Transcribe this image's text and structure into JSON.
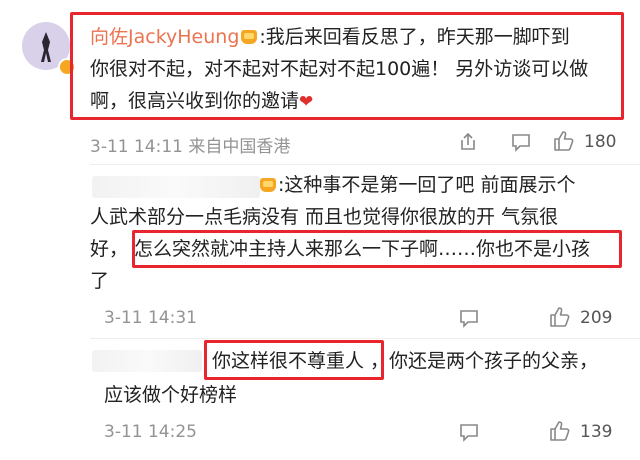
{
  "comment": {
    "author": "向佐JackyHeung",
    "line1": ":我后来回看反思了，昨天那一脚吓到",
    "line2": "你很对不起，对不起对不起对不起100遍！ 另外访谈可以做",
    "line3": "啊，很高兴收到你的邀请",
    "time": "3-11 14:11",
    "source": "来自中国香港",
    "likes": "180"
  },
  "replies": [
    {
      "line1": ":这种事不是第一回了吧 前面展示个",
      "line2": "人武术部分一点毛病没有 而且也觉得你很放的开 气氛很",
      "line3a": "好，",
      "line3b": "怎么突然就冲主持人来那么一下子啊……你也不是小孩",
      "line4": "了",
      "time": "3-11 14:31",
      "likes": "209"
    },
    {
      "line1a": "你这样很不尊重人",
      "line1b": "，你还是两个孩子的父亲，",
      "line2": "应该做个好榜样",
      "time": "3-11 14:25",
      "likes": "139"
    }
  ],
  "colors": {
    "accent": "#eb7350",
    "highlight_box": "#e8262f",
    "meta": "#939393"
  }
}
